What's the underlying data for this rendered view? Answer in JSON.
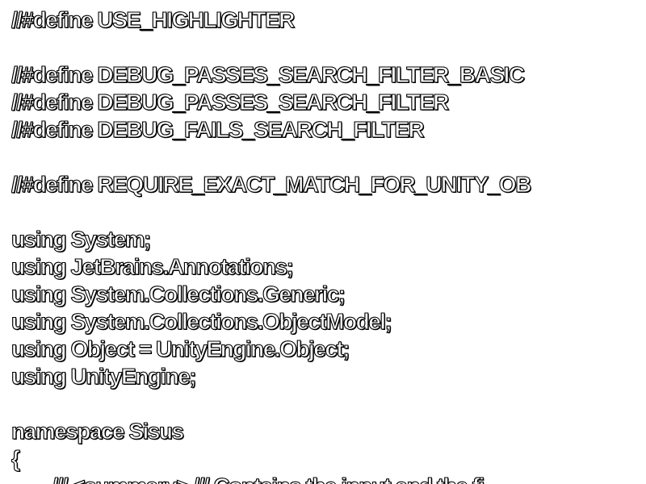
{
  "editor": {
    "lines": [
      "//#define USE_HIGHLIGHTER",
      "",
      "//#define DEBUG_PASSES_SEARCH_FILTER_BASIC",
      "//#define DEBUG_PASSES_SEARCH_FILTER",
      "//#define DEBUG_FAILS_SEARCH_FILTER",
      "",
      "//#define REQUIRE_EXACT_MATCH_FOR_UNITY_OB",
      "",
      "using System;",
      "using JetBrains.Annotations;",
      "using System.Collections.Generic;",
      "using System.Collections.ObjectModel;",
      "using Object = UnityEngine.Object;",
      "using UnityEngine;",
      "",
      "namespace Sisus",
      "{",
      "        /// <summary> /// Contains the input and the fi"
    ]
  }
}
